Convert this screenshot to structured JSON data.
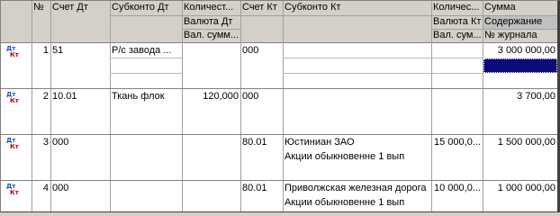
{
  "headers": {
    "num": "№",
    "schet_dt": "Счет Дт",
    "subkonto_dt": "Субконто Дт",
    "kolichestvo_dt": "Количест...",
    "valyuta_dt": "Валюта Дт",
    "val_summa_dt": "Вал. сумм...",
    "schet_kt": "Счет Кт",
    "subkonto_kt": "Субконто Кт",
    "kolichestvo_kt": "Количес...",
    "valyuta_kt": "Валюта Кт",
    "val_summa_kt": "Вал. сум...",
    "summa": "Сумма",
    "soderzhanie": "Содержание",
    "nomer_zhurnala": "№ журнала"
  },
  "rows": [
    {
      "num": "1",
      "schet_dt": "51",
      "subkonto_dt": "Р/с завода ...",
      "kol_dt": "",
      "schet_kt": "000",
      "subkonto_kt": "",
      "kol_kt": "",
      "summa": "3 000 000,00",
      "subkonto_kt2": "",
      "selected_cell": true
    },
    {
      "num": "2",
      "schet_dt": "10.01",
      "subkonto_dt": "Ткань флок",
      "kol_dt": "120,000",
      "schet_kt": "000",
      "subkonto_kt": "",
      "kol_kt": "",
      "summa": "3 700,00",
      "subkonto_kt2": ""
    },
    {
      "num": "3",
      "schet_dt": "000",
      "subkonto_dt": "",
      "kol_dt": "",
      "schet_kt": "80.01",
      "subkonto_kt": "Юстиниан ЗАО",
      "kol_kt": "15 000,0...",
      "summa": "1 500 000,00",
      "subkonto_kt2": "Акции обыкновенне 1 вып"
    },
    {
      "num": "4",
      "schet_dt": "000",
      "subkonto_dt": "",
      "kol_dt": "",
      "schet_kt": "80.01",
      "subkonto_kt": "Приволжская железная дорога",
      "kol_kt": "10 000,0...",
      "summa": "1 000 000,00",
      "subkonto_kt2": "Акции обыкновенне 1 вып"
    }
  ],
  "row_icon": {
    "dt": "Дт",
    "kt": "Кт"
  },
  "colors": {
    "selection": "#0b0b7a",
    "dt_icon": "#1f4fbf",
    "kt_icon": "#c00000",
    "header_bg": "#d4d0c8"
  }
}
